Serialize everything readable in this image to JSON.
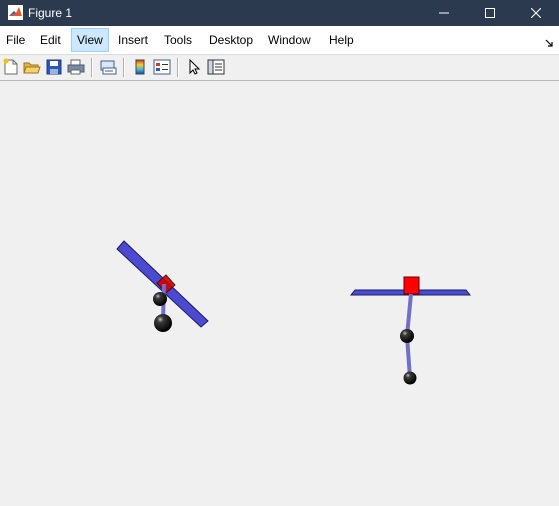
{
  "window": {
    "title": "Figure 1",
    "app_icon": "matlab-icon",
    "controls": [
      "minimize-icon",
      "maximize-icon",
      "close-icon"
    ]
  },
  "menubar": {
    "items": [
      {
        "label": "File"
      },
      {
        "label": "Edit"
      },
      {
        "label": "View",
        "active": true
      },
      {
        "label": "Insert"
      },
      {
        "label": "Tools"
      },
      {
        "label": "Desktop"
      },
      {
        "label": "Window"
      },
      {
        "label": "Help"
      }
    ],
    "dock_icon": "dock-arrow-icon"
  },
  "toolbar": {
    "buttons": [
      "new-figure-icon",
      "open-file-icon",
      "save-icon",
      "print-icon",
      "link-plot-icon",
      "insert-colorbar-icon",
      "insert-legend-icon",
      "edit-plot-arrow-icon",
      "property-inspector-icon"
    ]
  },
  "colors": {
    "titlebar": "#2b3a4e",
    "platform": "#4b4bd2",
    "rod": "#7070c8",
    "pivot_box": "#ff0000",
    "ball": "#000000",
    "background": "#f0f0f0"
  }
}
